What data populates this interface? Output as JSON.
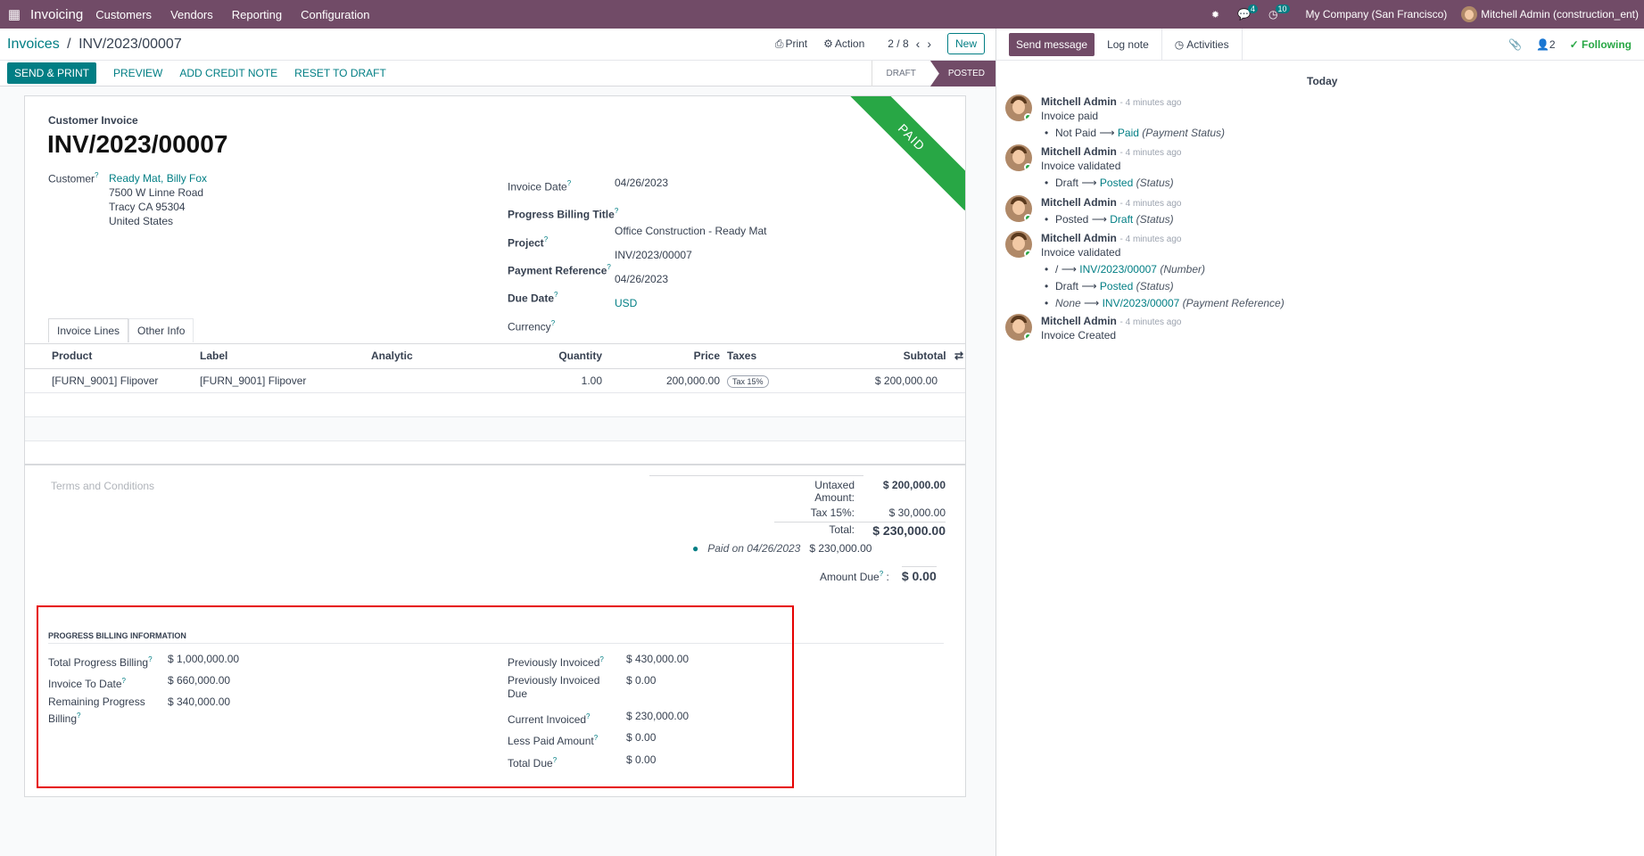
{
  "topbar": {
    "app_name": "Invoicing",
    "menus": [
      "Customers",
      "Vendors",
      "Reporting",
      "Configuration"
    ],
    "messages_count": "4",
    "activities_count": "10",
    "company": "My Company (San Francisco)",
    "user": "Mitchell Admin (construction_ent)"
  },
  "control": {
    "breadcrumb_parent": "Invoices",
    "breadcrumb_sep": "/",
    "breadcrumb_current": "INV/2023/00007",
    "print": "Print",
    "action": "Action",
    "pager": "2 / 8",
    "new": "New"
  },
  "actions": {
    "send_print": "SEND & PRINT",
    "preview": "PREVIEW",
    "credit_note": "ADD CREDIT NOTE",
    "reset": "RESET TO DRAFT",
    "status_draft": "DRAFT",
    "status_posted": "POSTED"
  },
  "invoice": {
    "ribbon": "PAID",
    "type": "Customer Invoice",
    "number": "INV/2023/00007",
    "customer_label": "Customer",
    "customer_name": "Ready Mat, Billy Fox",
    "address1": "7500 W Linne Road",
    "address2": "Tracy CA 95304",
    "address3": "United States",
    "invoice_date_label": "Invoice Date",
    "invoice_date": "04/26/2023",
    "pb_title_label": "Progress Billing Title",
    "project_label": "Project",
    "project": "Office Construction - Ready Mat",
    "payref_label": "Payment Reference",
    "payref": "INV/2023/00007",
    "due_label": "Due Date",
    "due": "04/26/2023",
    "currency_label": "Currency",
    "currency": "USD"
  },
  "tabs": [
    "Invoice Lines",
    "Other Info"
  ],
  "lines": {
    "headers": [
      "Product",
      "Label",
      "Analytic",
      "Quantity",
      "Price",
      "Taxes",
      "Subtotal"
    ],
    "rows": [
      {
        "product": "[FURN_9001] Flipover",
        "label": "[FURN_9001] Flipover",
        "analytic": "",
        "qty": "1.00",
        "price": "200,000.00",
        "tax": "Tax 15%",
        "subtotal": "$ 200,000.00"
      }
    ]
  },
  "terms": "Terms and Conditions",
  "totals": {
    "untaxed_label": "Untaxed Amount:",
    "untaxed": "$ 200,000.00",
    "tax_label": "Tax 15%:",
    "tax": "$ 30,000.00",
    "total_label": "Total:",
    "total": "$ 230,000.00",
    "paid_label": "Paid on 04/26/2023",
    "paid": "$ 230,000.00",
    "due_label": "Amount Due",
    "due": "$ 0.00"
  },
  "progress": {
    "title": "PROGRESS BILLING INFORMATION",
    "total_pb_label": "Total Progress Billing",
    "total_pb": "$ 1,000,000.00",
    "to_date_label": "Invoice To Date",
    "to_date": "$ 660,000.00",
    "remaining_label_1": "Remaining Progress",
    "remaining_label_2": "Billing",
    "remaining": "$ 340,000.00",
    "prev_inv_label": "Previously Invoiced",
    "prev_inv": "$ 430,000.00",
    "prev_due_label_1": "Previously Invoiced",
    "prev_due_label_2": "Due",
    "prev_due": "$ 0.00",
    "current_label": "Current Invoiced",
    "current": "$ 230,000.00",
    "less_paid_label": "Less Paid Amount",
    "less_paid": "$ 0.00",
    "total_due_label": "Total Due",
    "total_due": "$ 0.00"
  },
  "chatter": {
    "send": "Send message",
    "log": "Log note",
    "activities": "Activities",
    "followers": "2",
    "following": "Following",
    "today": "Today",
    "author": "Mitchell Admin",
    "time": "- 4 minutes ago",
    "m1_body": "Invoice paid",
    "m1_from": "Not Paid",
    "m1_to": "Paid",
    "m1_field": "(Payment Status)",
    "m2_body": "Invoice validated",
    "m2_from": "Draft",
    "m2_to": "Posted",
    "m2_field": "(Status)",
    "m3_from": "Posted",
    "m3_to": "Draft",
    "m3_field": "(Status)",
    "m4_body": "Invoice validated",
    "m4_a_from": "/",
    "m4_a_to": "INV/2023/00007",
    "m4_a_field": "(Number)",
    "m4_b_from": "Draft",
    "m4_b_to": "Posted",
    "m4_b_field": "(Status)",
    "m4_c_from": "None",
    "m4_c_to": "INV/2023/00007",
    "m4_c_field": "(Payment Reference)",
    "m5_body": "Invoice Created"
  }
}
